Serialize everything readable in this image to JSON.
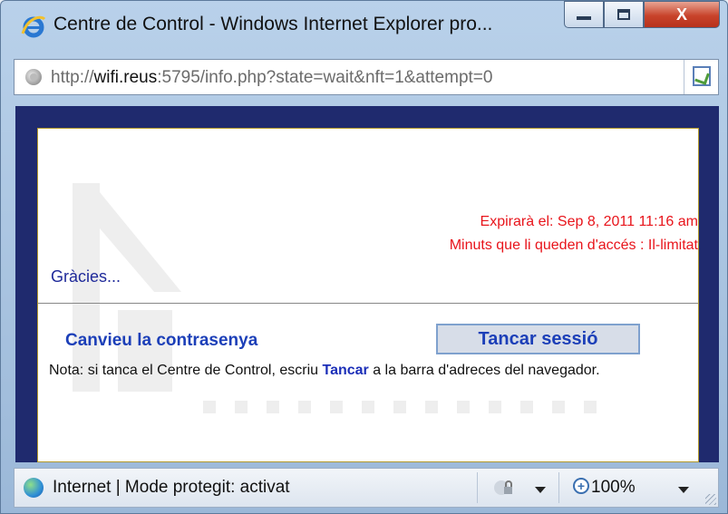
{
  "window": {
    "title": "Centre de Control - Windows Internet Explorer pro...",
    "close_label": "X"
  },
  "address": {
    "prefix": "http://",
    "host": "wifi.reus",
    "rest": ":5795/info.php?state=wait&nft=1&attempt=0"
  },
  "content": {
    "expire_line": "Expirarà el: Sep 8, 2011 11:16 am",
    "minutes_line": "Minuts que li queden d'accés : Il-limitat",
    "thanks": "Gràcies...",
    "change_password": "Canvieu la contrasenya",
    "logout_button": "Tancar sessió",
    "note_prefix": "Nota: si tanca el Centre de Control, escriu ",
    "note_keyword": "Tancar",
    "note_suffix": " a la barra d'adreces del navegador."
  },
  "status": {
    "zone": "Internet | Mode protegit: activat",
    "zoom": "100%"
  },
  "colors": {
    "frame_navy": "#1f2a6e",
    "expire_red": "#e8141b",
    "link_blue": "#1c3fb8"
  }
}
